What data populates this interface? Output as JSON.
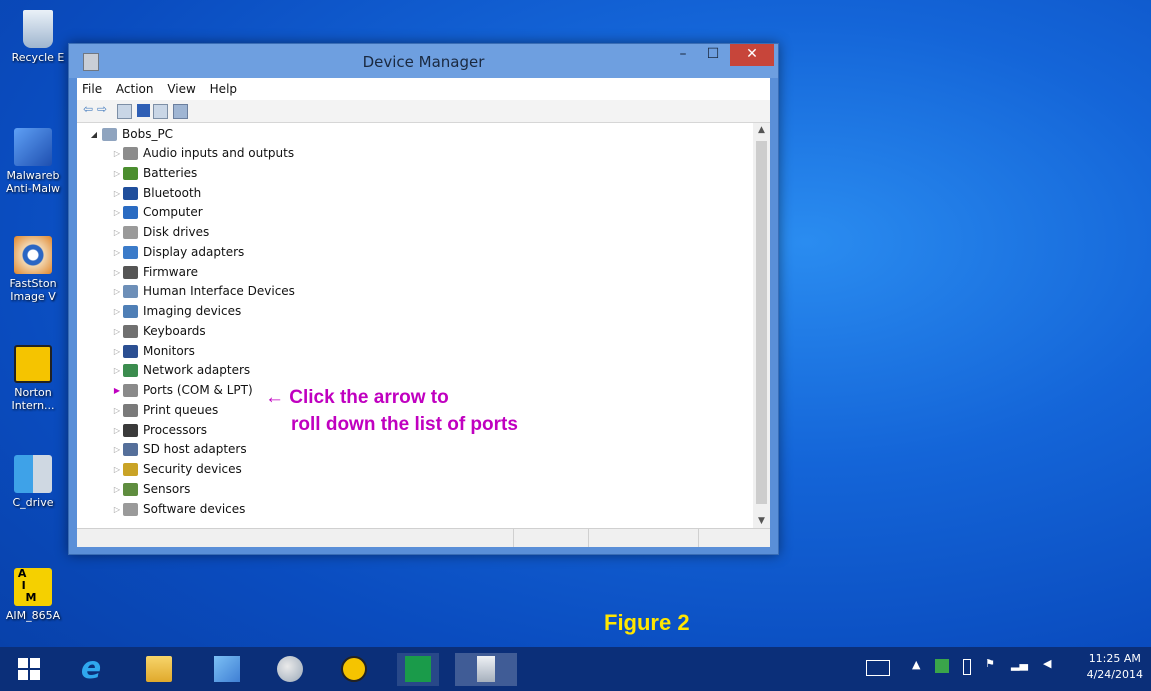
{
  "desktop": {
    "icons": [
      {
        "name": "recycle-bin-icon",
        "label": "Recycle E",
        "color": "#c7d6e8"
      },
      {
        "name": "malwarebytes-icon",
        "label1": "Malwareb",
        "label2": "Anti-Malw",
        "color": "#2e62c6"
      },
      {
        "name": "faststone-icon",
        "label1": "FastSton",
        "label2": "Image V",
        "color": "#e0852a"
      },
      {
        "name": "norton-icon",
        "label1": "Norton",
        "label2": "Intern...",
        "color": "#f5c400"
      },
      {
        "name": "c-drive-icon",
        "label": "C_drive",
        "color": "#3ea2e8"
      },
      {
        "name": "aim-icon",
        "label": "AIM_865A",
        "color": "#f5d000"
      }
    ]
  },
  "window": {
    "title": "Device Manager",
    "menu": [
      "File",
      "Action",
      "View",
      "Help"
    ],
    "tree_root": "Bobs_PC",
    "items": [
      {
        "label": "Audio inputs and outputs",
        "icon": "speaker-icon",
        "color": "#8c8c8c"
      },
      {
        "label": "Batteries",
        "icon": "battery-icon",
        "color": "#4b8e2f"
      },
      {
        "label": "Bluetooth",
        "icon": "bluetooth-icon",
        "color": "#1f4e9c"
      },
      {
        "label": "Computer",
        "icon": "computer-icon",
        "color": "#2a6bc2"
      },
      {
        "label": "Disk drives",
        "icon": "disk-drive-icon",
        "color": "#9a9a9a"
      },
      {
        "label": "Display adapters",
        "icon": "display-adapter-icon",
        "color": "#3b7bc9"
      },
      {
        "label": "Firmware",
        "icon": "firmware-icon",
        "color": "#555555"
      },
      {
        "label": "Human Interface Devices",
        "icon": "hid-icon",
        "color": "#6d8fb8"
      },
      {
        "label": "Imaging devices",
        "icon": "imaging-icon",
        "color": "#4f7fb6"
      },
      {
        "label": "Keyboards",
        "icon": "keyboard-icon",
        "color": "#707070"
      },
      {
        "label": "Monitors",
        "icon": "monitor-icon",
        "color": "#2b4f92"
      },
      {
        "label": "Network adapters",
        "icon": "network-icon",
        "color": "#3b8c4e"
      },
      {
        "label": "Ports (COM & LPT)",
        "icon": "port-icon",
        "color": "#8a8a8a"
      },
      {
        "label": "Print queues",
        "icon": "printer-icon",
        "color": "#7a7a7a"
      },
      {
        "label": "Processors",
        "icon": "processor-icon",
        "color": "#3a3a3a"
      },
      {
        "label": "SD host adapters",
        "icon": "sd-adapter-icon",
        "color": "#556f9a"
      },
      {
        "label": "Security devices",
        "icon": "security-icon",
        "color": "#c9a326"
      },
      {
        "label": "Sensors",
        "icon": "sensor-icon",
        "color": "#5f8d3f"
      },
      {
        "label": "Software devices",
        "icon": "software-device-icon",
        "color": "#9a9a9a"
      }
    ]
  },
  "annotation": {
    "line1": "← Click the arrow to",
    "line2": "roll down the list of ports"
  },
  "figure_label": "Figure 2",
  "taskbar": {
    "time": "11:25 AM",
    "date": "4/24/2014"
  }
}
